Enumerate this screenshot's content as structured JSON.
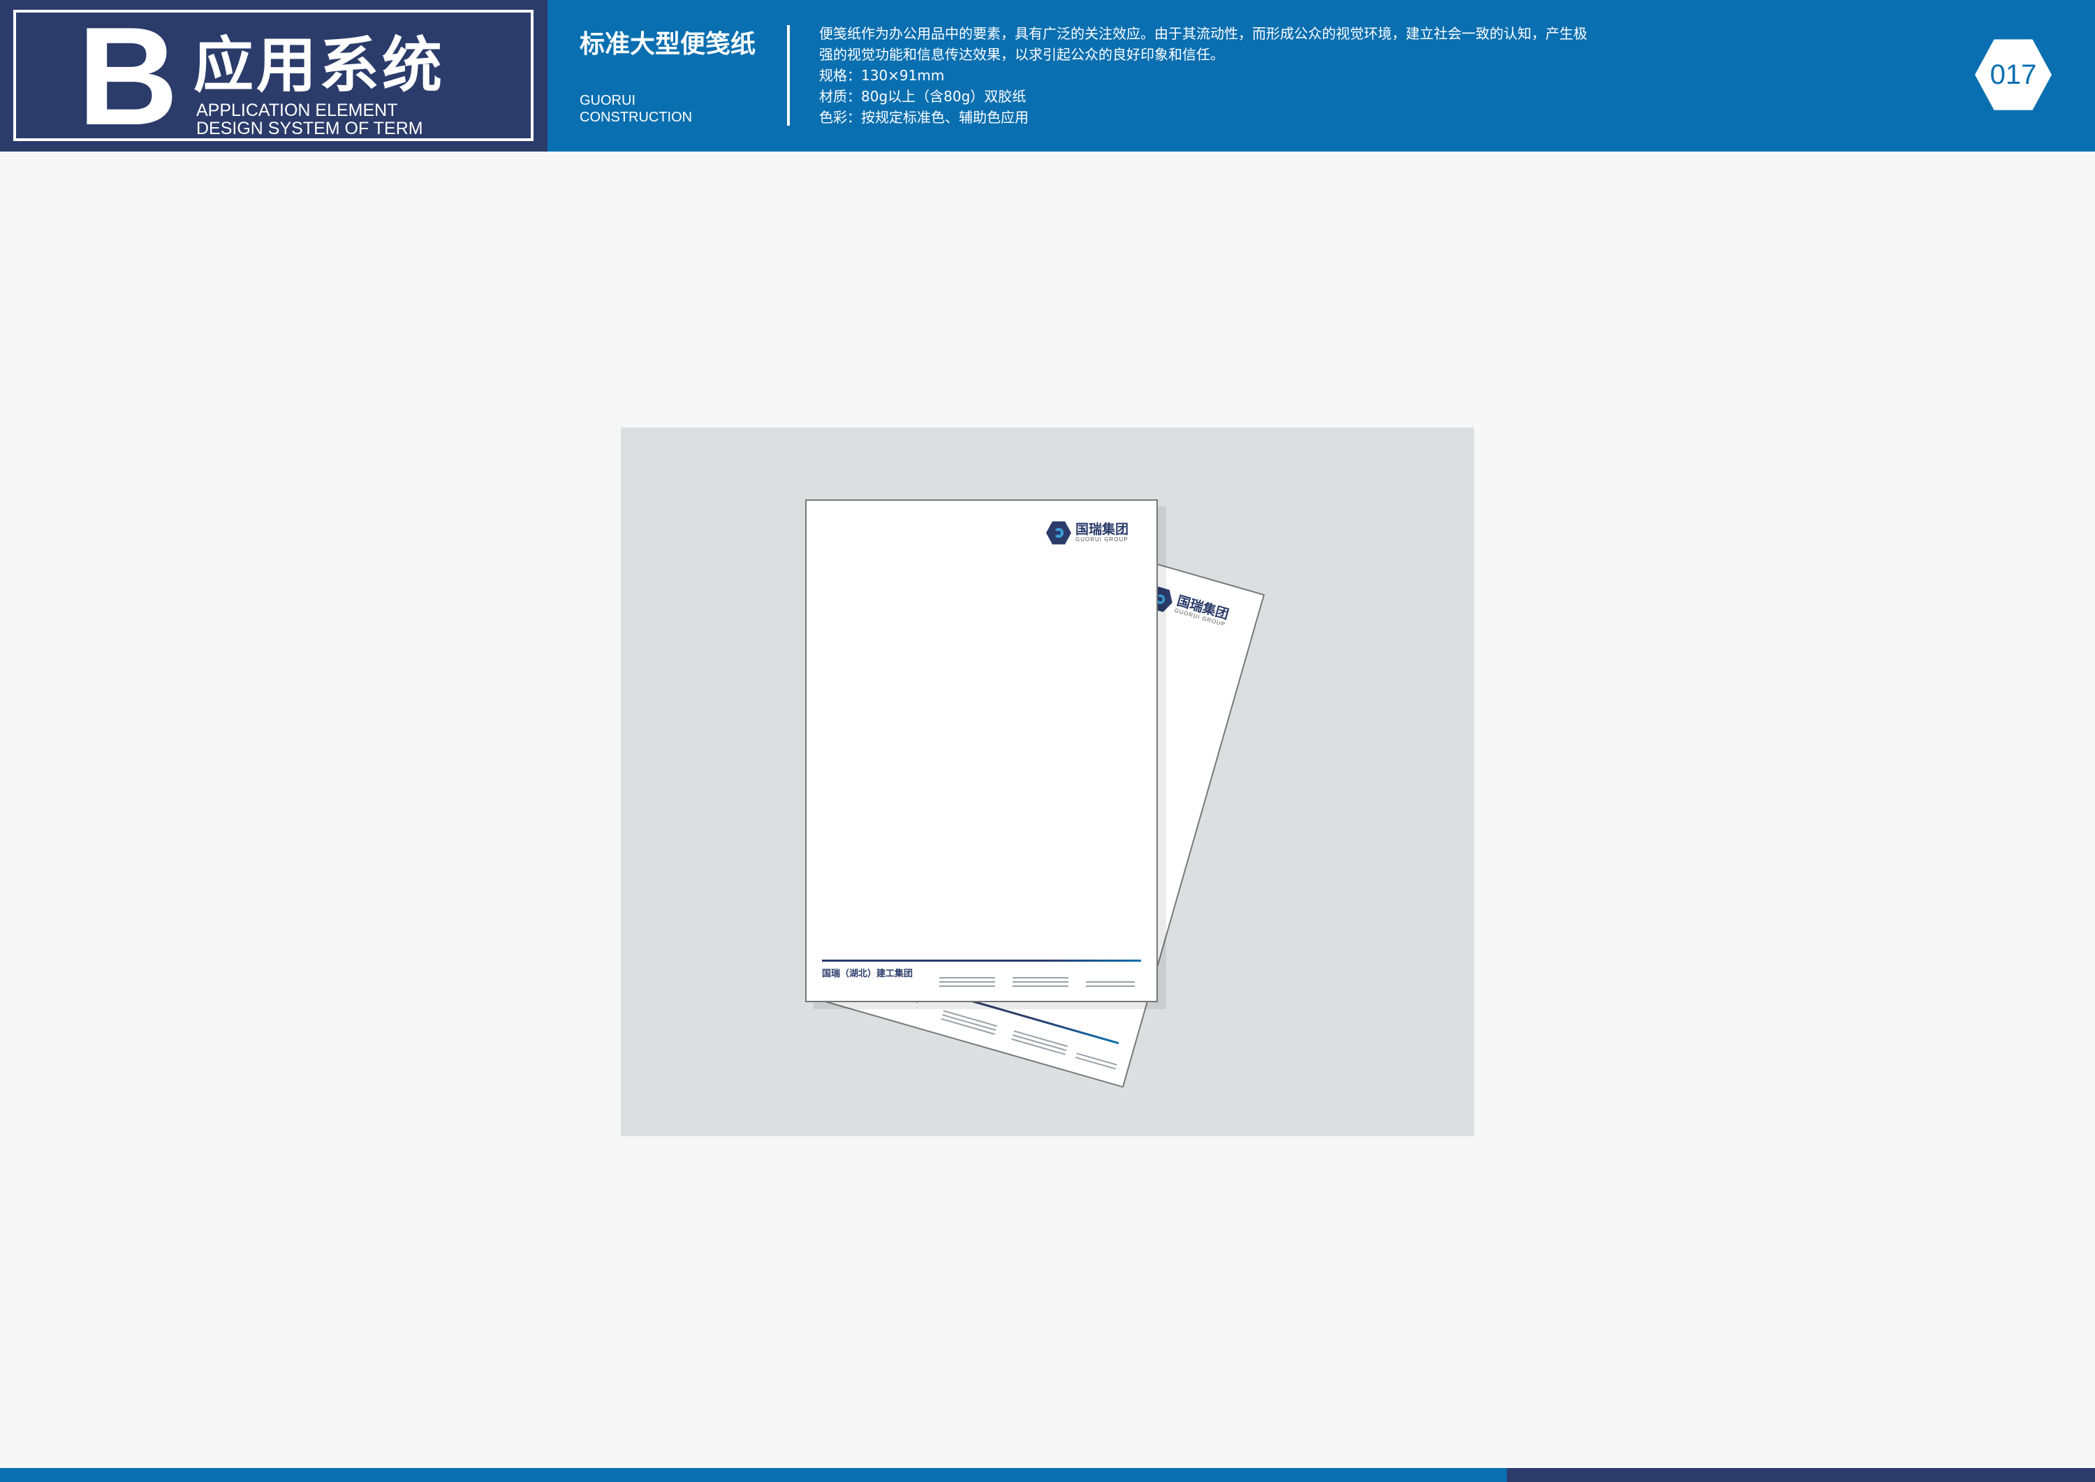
{
  "header": {
    "brand_letter": "B",
    "brand_title": "应用系统",
    "brand_sub_line1": "APPLICATION ELEMENT",
    "brand_sub_line2": "DESIGN SYSTEM OF TERM",
    "section_title": "标准大型便笺纸",
    "section_sub_line1": "GUORUI",
    "section_sub_line2": "CONSTRUCTION",
    "description": [
      "便笺纸作为办公用品中的要素，具有广泛的关注效应。由于其流动性，而形成公众的视觉环境，建立社会一致的认知，产生极",
      "强的视觉功能和信息传达效果，以求引起公众的良好印象和信任。",
      "规格：130×91mm",
      "材质：80g以上（含80g）双胶纸",
      "色彩：按规定标准色、辅助色应用"
    ],
    "page_number": "017"
  },
  "mockup": {
    "logo_cn": "国瑞集团",
    "logo_en": "GUORUI GROUP",
    "footer_company": "国瑞（湖北）建工集团"
  },
  "colors": {
    "primary_blue": "#0a6fb0",
    "navy": "#2b3c6b",
    "mockup_bg": "#dcdfdf",
    "page_bg": "#f7f7f7"
  },
  "icons": [
    "guorui-logo-icon",
    "page-number-hexagon-icon"
  ]
}
